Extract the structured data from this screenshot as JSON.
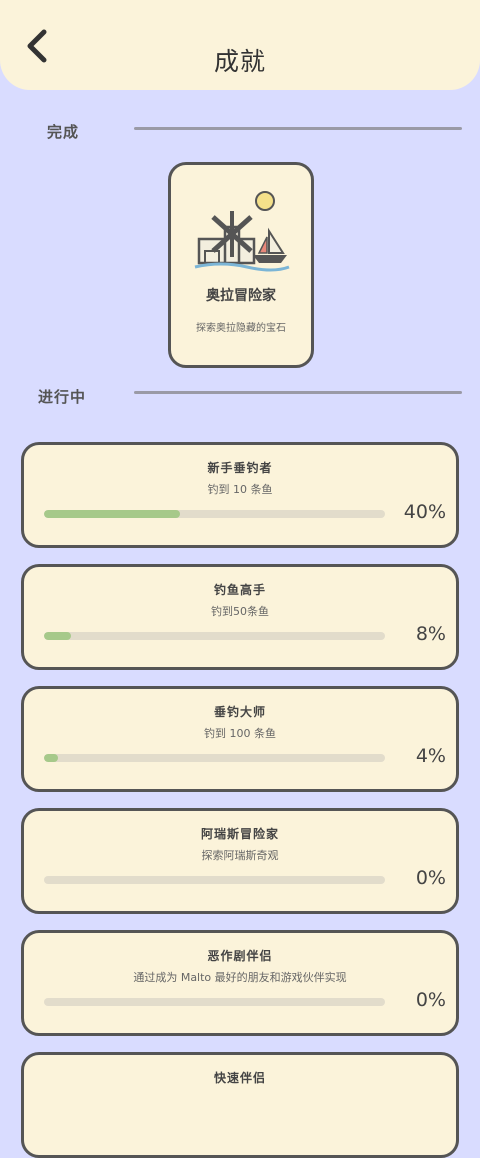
{
  "header": {
    "title": "成就",
    "back_icon": "chevron-left-icon"
  },
  "sections": {
    "completed_label": "完成",
    "in_progress_label": "进行中"
  },
  "completed": [
    {
      "title": "奥拉冒险家",
      "desc": "探索奥拉隐藏的宝石",
      "icon": "windmill-island-icon"
    }
  ],
  "in_progress": [
    {
      "title": "新手垂钓者",
      "desc": "钓到 10 条鱼",
      "percent_label": "40%",
      "progress": 0.4
    },
    {
      "title": "钓鱼高手",
      "desc": "钓到50条鱼",
      "percent_label": "8%",
      "progress": 0.08
    },
    {
      "title": "垂钓大师",
      "desc": "钓到 100 条鱼",
      "percent_label": "4%",
      "progress": 0.04
    },
    {
      "title": "阿瑞斯冒险家",
      "desc": "探索阿瑞斯奇观",
      "percent_label": "0%",
      "progress": 0
    },
    {
      "title": "恶作剧伴侣",
      "desc": "通过成为 Malto 最好的朋友和游戏伙伴实现",
      "percent_label": "0%",
      "progress": 0
    },
    {
      "title": "快速伴侣",
      "desc": "",
      "percent_label": "",
      "progress": 0
    }
  ],
  "colors": {
    "background": "#d9dcff",
    "card": "#fbf3da",
    "progress_fill": "#a6c98a",
    "progress_track": "#e2dccb"
  }
}
